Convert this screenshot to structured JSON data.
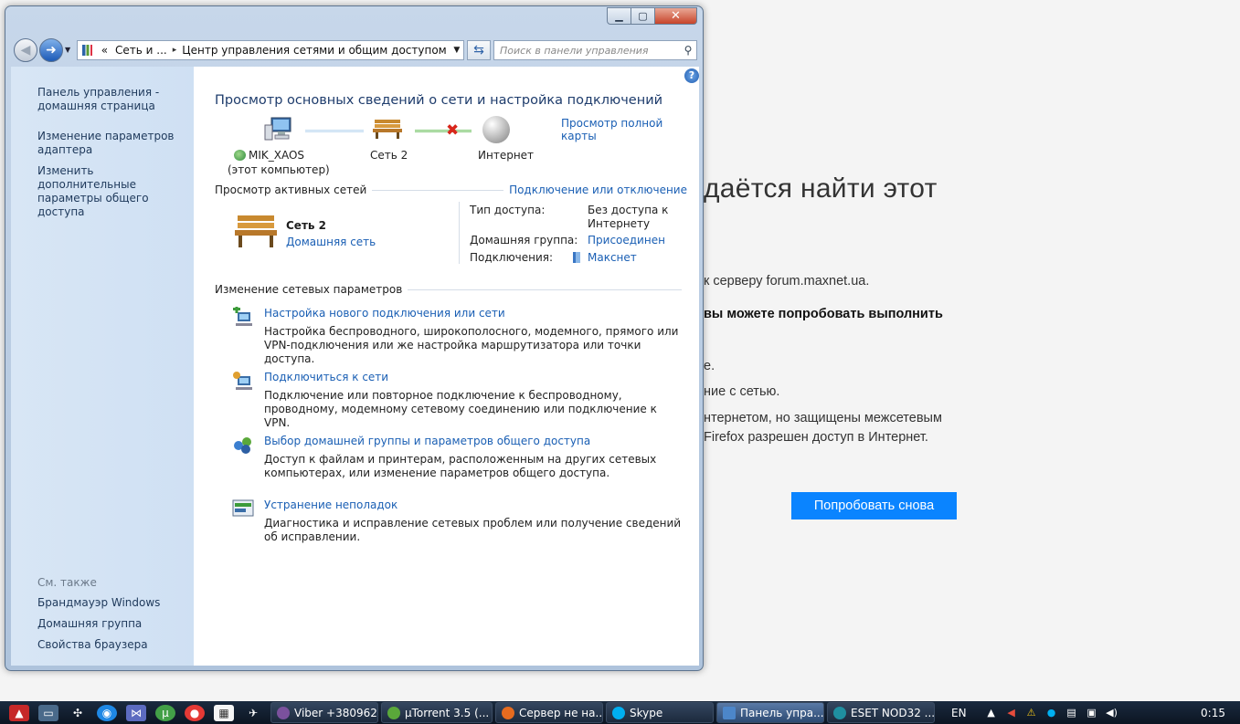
{
  "background_page": {
    "heading": "дaётся найти этот",
    "line1": "к серверу forum.maxnet.ua.",
    "line2": "вы можете попробовать выполнить",
    "line3": "е.",
    "line4": "ние с сетью.",
    "line5": "нтернетом, но защищены межсетевым",
    "line6": "Firefox разрешен доступ в Интернет.",
    "retry_button": "Попробовать снова"
  },
  "window": {
    "controls": {
      "minimize": "▁",
      "maximize": "▢",
      "close": "✕"
    },
    "address": {
      "prefix": "«",
      "segments": [
        "Сеть и ...",
        "Центр управления сетями и общим доступом"
      ],
      "separator": "▸"
    },
    "search": {
      "placeholder": "Поиск в панели управления"
    }
  },
  "sidebar": {
    "home": "Панель управления - домашняя страница",
    "adapter": "Изменение параметров адаптера",
    "sharing": "Изменить дополнительные параметры общего доступа",
    "see_also": "См. также",
    "firewall": "Брандмауэр Windows",
    "homegroup": "Домашняя группа",
    "browser": "Свойства браузера"
  },
  "main": {
    "help": "?",
    "title": "Просмотр основных сведений о сети и настройка подключений",
    "full_map": "Просмотр полной карты",
    "map": {
      "computer_name": "MIK_XAOS",
      "computer_sub": "(этот компьютер)",
      "network_name": "Сеть  2",
      "internet_name": "Интернет"
    },
    "active_head": "Просмотр активных сетей",
    "connect_link": "Подключение или отключение",
    "active_network": {
      "name": "Сеть  2",
      "type": "Домашняя сеть",
      "access_label": "Тип доступа:",
      "access_value": "Без доступа к Интернету",
      "homegroup_label": "Домашняя группа:",
      "homegroup_value": "Присоединен",
      "connections_label": "Подключения:",
      "connections_value": "Макснет"
    },
    "change_head": "Изменение сетевых параметров",
    "tasks": [
      {
        "link": "Настройка нового подключения или сети",
        "desc": "Настройка беспроводного, широкополосного, модемного, прямого или VPN-подключения или же настройка маршрутизатора или точки доступа."
      },
      {
        "link": "Подключиться к сети",
        "desc": "Подключение или повторное подключение к беспроводному, проводному, модемному сетевому соединению или подключение к VPN."
      },
      {
        "link": "Выбор домашней группы и параметров общего доступа",
        "desc": "Доступ к файлам и принтерам, расположенным на других сетевых компьютерах, или изменение параметров общего доступа."
      },
      {
        "link": "Устранение неполадок",
        "desc": "Диагностика и исправление сетевых проблем или получение сведений об исправлении."
      }
    ]
  },
  "taskbar": {
    "tasks": [
      {
        "label": "Viber +380962...",
        "color": "#7b519d"
      },
      {
        "label": "µTorrent 3.5  (...",
        "color": "#5aa83a"
      },
      {
        "label": "Сервер не на...",
        "color": "#e66b1f"
      },
      {
        "label": "Skype",
        "color": "#00aff0"
      },
      {
        "label": "Панель упра...",
        "color": "#4c86c9"
      },
      {
        "label": "ESET NOD32 ...",
        "color": "#1f8fa0"
      }
    ],
    "lang": "EN",
    "clock": "0:15"
  }
}
